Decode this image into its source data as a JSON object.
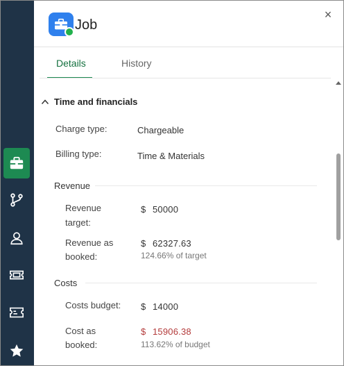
{
  "panel": {
    "title": "Job",
    "close_glyph": "×",
    "icon": "briefcase-icon",
    "status_color": "#22b14c"
  },
  "rail": {
    "items": [
      {
        "icon": "briefcase-icon",
        "active": true
      },
      {
        "icon": "git-branch-icon",
        "active": false
      },
      {
        "icon": "person-icon",
        "active": false
      },
      {
        "icon": "ticket-icon",
        "active": false
      },
      {
        "icon": "card-ticket-icon",
        "active": false
      },
      {
        "icon": "star-icon",
        "active": false
      }
    ],
    "background": "#1f3347",
    "accent": "#1d8a52"
  },
  "tabs": [
    {
      "label": "Details",
      "active": true
    },
    {
      "label": "History",
      "active": false
    }
  ],
  "section": {
    "title": "Time and financials",
    "expanded": true,
    "charge_type_label": "Charge type:",
    "charge_type_value": "Chargeable",
    "billing_type_label": "Billing type:",
    "billing_type_value": "Time & Materials"
  },
  "revenue": {
    "heading": "Revenue",
    "target_label_1": "Revenue",
    "target_label_2": "target:",
    "target_currency": "$",
    "target_value": "50000",
    "booked_label_1": "Revenue as",
    "booked_label_2": "booked:",
    "booked_currency": "$",
    "booked_value": "62327.63",
    "booked_pct": "124.66% of target"
  },
  "costs": {
    "heading": "Costs",
    "budget_label": "Costs budget:",
    "budget_currency": "$",
    "budget_value": "14000",
    "booked_label_1": "Cost as",
    "booked_label_2": "booked:",
    "booked_currency": "$",
    "booked_value": "15906.38",
    "booked_pct": "113.62% of budget",
    "over_budget_color": "#b33a3a"
  }
}
